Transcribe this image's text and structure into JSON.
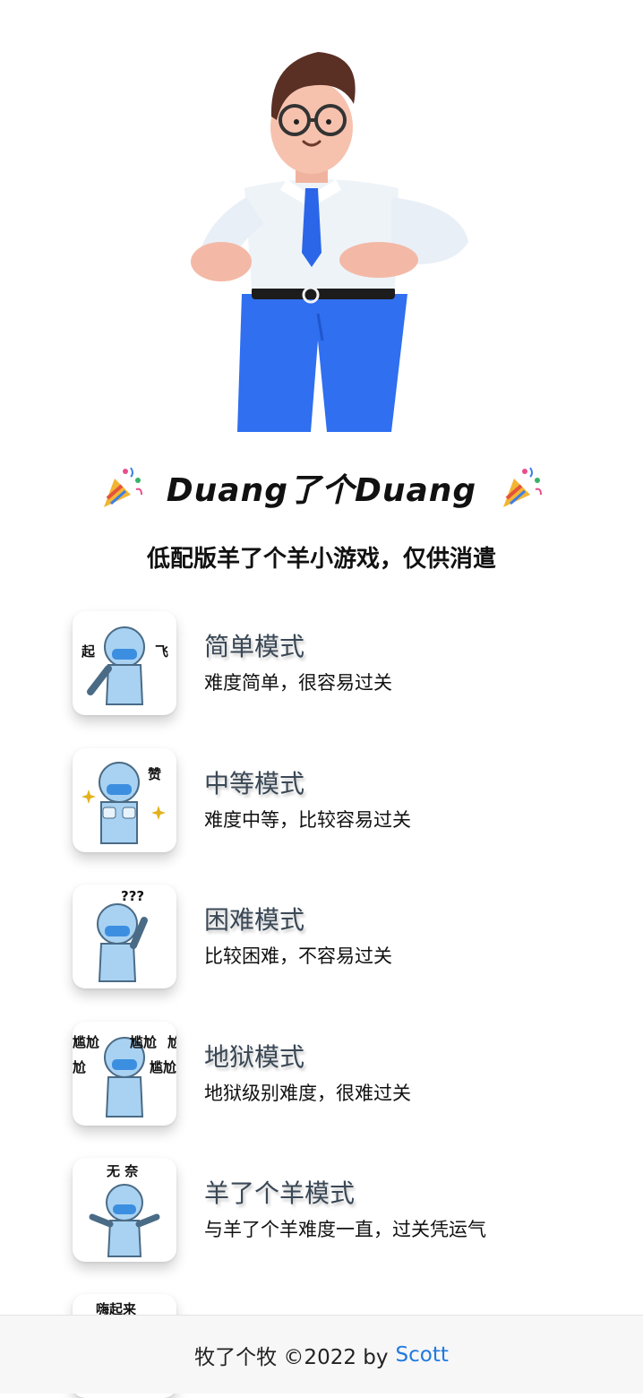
{
  "header": {
    "title": "Duang了个Duang",
    "subtitle": "低配版羊了个羊小游戏，仅供消遣"
  },
  "modes": [
    {
      "name": "简单模式",
      "desc": "难度简单，很容易过关",
      "caption_left": "起",
      "caption_right": "飞"
    },
    {
      "name": "中等模式",
      "desc": "难度中等，比较容易过关",
      "caption_right": "赞"
    },
    {
      "name": "困难模式",
      "desc": "比较困难，不容易过关",
      "caption_right": "???"
    },
    {
      "name": "地狱模式",
      "desc": "地狱级别难度，很难过关",
      "caption_a": "尴尬",
      "caption_b": "尴尬",
      "caption_c": "尬",
      "caption_d": "尬",
      "caption_e": "尴尬"
    },
    {
      "name": "羊了个羊模式",
      "desc": "与羊了个羊难度一直，过关凭运气",
      "caption_top": "无 奈"
    },
    {
      "caption_top": "嗨起来"
    }
  ],
  "footer": {
    "text": "牧了个牧 ©2022 by",
    "author": "Scott"
  },
  "colors": {
    "accent_link": "#1f7ae0",
    "mode_title": "#3a4856",
    "suit_blue": "#a9d2f2"
  }
}
